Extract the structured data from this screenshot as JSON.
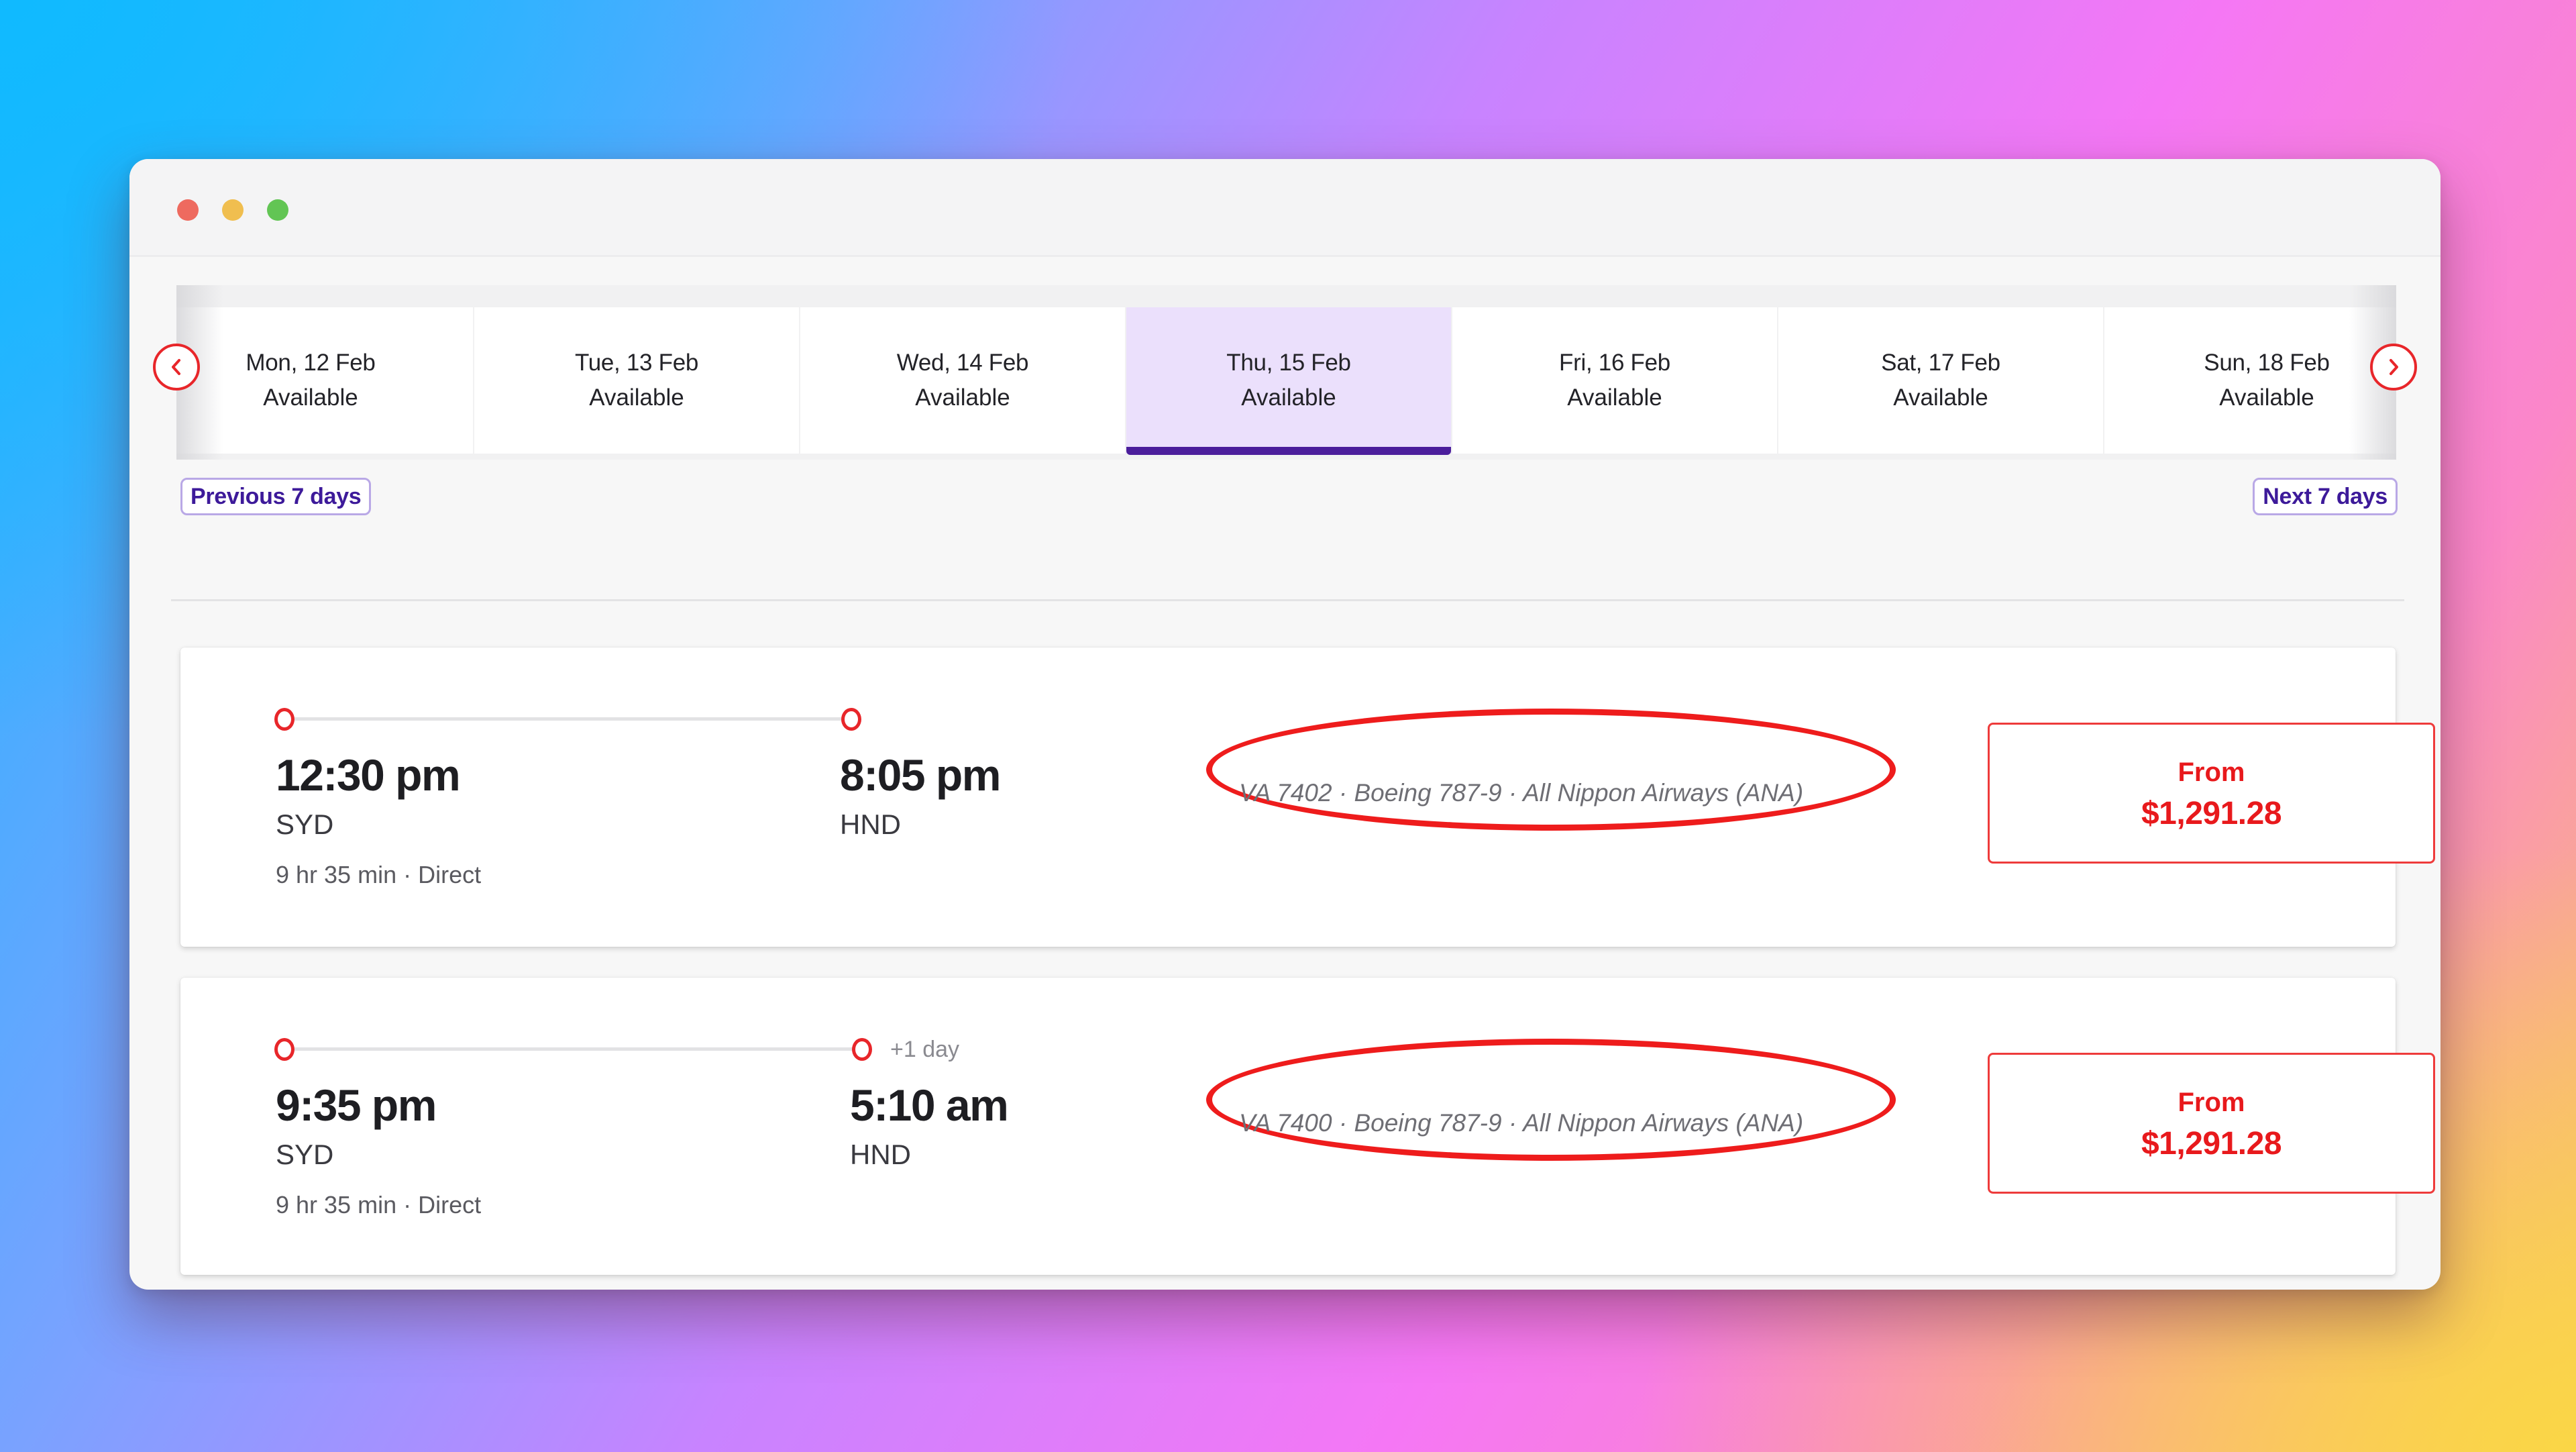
{
  "window": {
    "controls": [
      "close",
      "minimize",
      "maximize"
    ]
  },
  "date_strip": {
    "tabs": [
      {
        "date": "Mon, 12 Feb",
        "status": "Available",
        "selected": false
      },
      {
        "date": "Tue, 13 Feb",
        "status": "Available",
        "selected": false
      },
      {
        "date": "Wed, 14 Feb",
        "status": "Available",
        "selected": false
      },
      {
        "date": "Thu, 15 Feb",
        "status": "Available",
        "selected": true
      },
      {
        "date": "Fri, 16 Feb",
        "status": "Available",
        "selected": false
      },
      {
        "date": "Sat, 17 Feb",
        "status": "Available",
        "selected": false
      },
      {
        "date": "Sun, 18 Feb",
        "status": "Available",
        "selected": false
      }
    ],
    "prev_icon": "chevron-left-icon",
    "next_icon": "chevron-right-icon",
    "previous_label": "Previous 7 days",
    "next_label": "Next 7 days"
  },
  "flights": [
    {
      "depart_time": "12:30 pm",
      "depart_code": "SYD",
      "arrive_time": "8:05 pm",
      "arrive_code": "HND",
      "day_offset": "",
      "duration": "9 hr 35 min",
      "stops": "Direct",
      "flight_number": "VA 7402",
      "aircraft": "Boeing 787-9",
      "operator": "All Nippon Airways (ANA)",
      "price_prefix": "From",
      "price": "$1,291.28"
    },
    {
      "depart_time": "9:35 pm",
      "depart_code": "SYD",
      "arrive_time": "5:10 am",
      "arrive_code": "HND",
      "day_offset": "+1 day",
      "duration": "9 hr 35 min",
      "stops": "Direct",
      "flight_number": "VA 7400",
      "aircraft": "Boeing 787-9",
      "operator": "All Nippon Airways (ANA)",
      "price_prefix": "From",
      "price": "$1,291.28"
    }
  ],
  "separator_dot": " · ",
  "colors": {
    "accent_red": "#e8191c",
    "selected_tab_bg": "#ebe0fc",
    "selected_tab_underline": "#4a1d9b",
    "link_purple": "#3d1a9a"
  }
}
